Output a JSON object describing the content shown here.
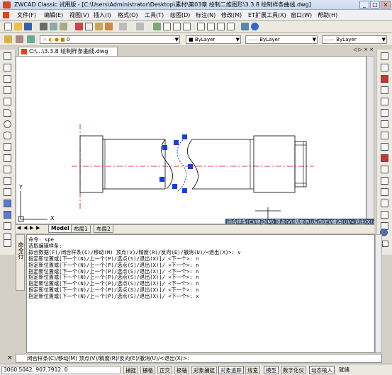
{
  "window": {
    "title": "ZWCAD Classic 试用版 - [C:\\Users\\Administrator\\Desktop\\素材\\第03章 绘制二维图形\\3.3.8 绘制样条曲线.dwg]",
    "min": "_",
    "max": "□",
    "close": "×"
  },
  "menu": [
    "文件(F)",
    "编辑(E)",
    "视图(V)",
    "插入(I)",
    "格式(O)",
    "工具(T)",
    "绘图(D)",
    "标注(N)",
    "修改(M)",
    "ET扩展工具(X)",
    "窗口(W)",
    "帮助(H)"
  ],
  "toolbar2": {
    "layer_value": "0",
    "color": "■ ByLayer",
    "linetype": "ByLayer",
    "lineweight": "ByLayer"
  },
  "document_tab": "C:\\...\\3.3.8 绘制样条曲线.dwg",
  "doc_tab_controls": "◁ ▷ × ×",
  "layout_tabs": [
    "Model",
    "布局1",
    "布局2"
  ],
  "layout_nav": [
    "◀",
    "◀",
    "▶",
    "▶"
  ],
  "hint_bar": "闭合样条(C)/移动(M) 顶点(V)/精度(R)/反向(E)/撤消(U)/<退出(X)>:",
  "ucs": {
    "x": "X",
    "y": "Y"
  },
  "cmd_label": "命令行",
  "command_history": [
    "命令: spe",
    "选取编辑样条:",
    "拟合数据(F)/闭合样条(C)/移动(M) 顶点(V)/精度(R)/反向(E)/撤消(U)/<退出(X)>: v",
    "指定新位置或[下一个(N)/上一个(P)/选点(S)/退出(X)]/ <下一个>: n",
    "指定新位置或[下一个(N)/上一个(P)/选点(S)/退出(X)]/ <下一个>: n",
    "指定新位置或[下一个(N)/上一个(P)/选点(S)/退出(X)]/ <下一个>: n",
    "指定新位置或[下一个(N)/上一个(P)/选点(S)/退出(X)]/ <下一个>: n",
    "指定新位置或[下一个(N)/上一个(P)/选点(S)/退出(X)]/ <下一个>: n",
    "指定新位置或[下一个(N)/上一个(P)/选点(S)/退出(X)]/ <下一个>: n",
    "指定新位置或[下一个(N)/上一个(P)/选点(S)/退出(X)]/ <下一个>: x"
  ],
  "command_input": "闭合样条(C)/移动(M) 顶点(V)/精度(R)/反向(E)/撤消(U)/<退出(X)>:",
  "status": {
    "coords": "3060.5042, 907.7912, 0",
    "buttons": [
      {
        "label": "捕捉",
        "on": false
      },
      {
        "label": "栅格",
        "on": false
      },
      {
        "label": "正交",
        "on": false
      },
      {
        "label": "极轴",
        "on": false
      },
      {
        "label": "对象捕捉",
        "on": false
      },
      {
        "label": "对象追踪",
        "on": true
      },
      {
        "label": "线宽",
        "on": false
      },
      {
        "label": "模型",
        "on": true
      },
      {
        "label": "数字化仪",
        "on": false
      },
      {
        "label": "动态输入",
        "on": true
      },
      {
        "label": "就绪",
        "on": false
      }
    ]
  },
  "colors": {
    "grip": "#1a3fd6",
    "centerline": "#e00000",
    "title_bg": "#c9d7ee",
    "hint_bg": "#3a4f6e"
  }
}
